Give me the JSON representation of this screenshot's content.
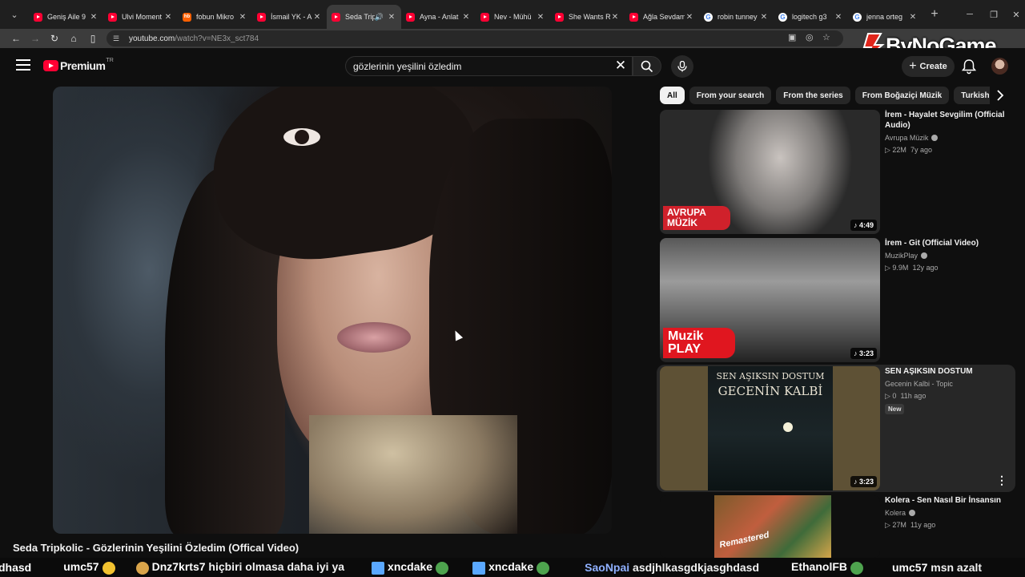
{
  "browser": {
    "tabs": [
      {
        "title": "Geniş Aile 9",
        "icon": "youtube-icon"
      },
      {
        "title": "Ulvi Moment",
        "icon": "youtube-icon"
      },
      {
        "title": "fobun Mikro",
        "icon": "hepsiburada-icon"
      },
      {
        "title": "İsmail YK - A",
        "icon": "youtube-icon"
      },
      {
        "title": "Seda Trip",
        "icon": "youtube-icon",
        "active": true,
        "audio": true
      },
      {
        "title": "Ayna - Anlat",
        "icon": "youtube-icon"
      },
      {
        "title": "Nev - Mühü",
        "icon": "youtube-icon"
      },
      {
        "title": "She Wants R",
        "icon": "youtube-icon"
      },
      {
        "title": "Ağla Sevdam",
        "icon": "youtube-icon"
      },
      {
        "title": "robin tunney",
        "icon": "google-icon"
      },
      {
        "title": "logitech g3",
        "icon": "google-icon"
      },
      {
        "title": "jenna orteg",
        "icon": "google-icon"
      }
    ],
    "url_host": "youtube.com",
    "url_path": "/watch?v=NE3x_sct784"
  },
  "overlay": {
    "brand": "ByNoGame"
  },
  "youtube": {
    "logo_word": "Premium",
    "logo_region": "TR",
    "search_query": "gözlerinin yeşilini özledim",
    "create_label": "Create",
    "video_title": "Seda Tripkolic - Gözlerinin Yeşilini Özledim (Offical Video)",
    "chips": [
      "All",
      "From your search",
      "From the series",
      "From Boğaziçi Müzik",
      "Turkish Pop Music"
    ],
    "recommendations": [
      {
        "title": "İrem - Hayalet Sevgilim (Official Audio)",
        "channel": "Avrupa Müzik",
        "views": "22M",
        "age": "7y ago",
        "duration": "4:49",
        "thumb_label": "AVRUPA MÜZİK"
      },
      {
        "title": "İrem - Git (Official Video)",
        "channel": "MuzikPlay",
        "views": "9.9M",
        "age": "12y ago",
        "duration": "3:23",
        "thumb_label": "Muzik PLAY"
      },
      {
        "title": "SEN AŞIKSIN DOSTUM",
        "channel": "Gecenin Kalbi - Topic",
        "views": "0",
        "age": "11h ago",
        "badge": "New",
        "duration": "3:23",
        "thumb_label": "SEN AŞIKSIN DOSTUM",
        "thumb_label2": "GECENİN KALBİ"
      },
      {
        "title": "Kolera - Sen Nasıl Bir İnsansın",
        "channel": "Kolera",
        "views": "27M",
        "age": "11y ago",
        "duration": "",
        "thumb_label": "Remastered"
      }
    ]
  },
  "ticker": {
    "items": [
      {
        "user": "dhasd",
        "message": ""
      },
      {
        "user": "umc57",
        "message": ""
      },
      {
        "user": "Dnz7krts7",
        "message": "hiçbiri olmasa daha iyi ya"
      },
      {
        "user": "xncdake",
        "message": ""
      },
      {
        "user": "xncdake",
        "message": ""
      },
      {
        "user": "SaoNpai",
        "message": "asdjhlkasgdkjasghdasd"
      },
      {
        "user": "EthanolFB",
        "message": ""
      },
      {
        "user": "umc57",
        "message": "msn azalt"
      }
    ]
  }
}
